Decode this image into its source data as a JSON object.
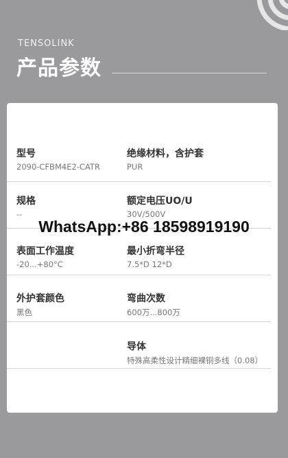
{
  "header": {
    "brand": "TENSOLINK",
    "title": "产品参数"
  },
  "specs": [
    {
      "label": "型号",
      "value": "2090-CFBM4E2-CATR"
    },
    {
      "label": "绝缘材料，含护套",
      "value": "PUR"
    },
    {
      "label": "规格",
      "value": "--"
    },
    {
      "label": "额定电压UO/U",
      "value": "30V/500V"
    },
    {
      "label": "表面工作温度",
      "value": "-20...+80°C"
    },
    {
      "label": "最小折弯半径",
      "value": "7.5*D   12*D"
    },
    {
      "label": "外护套颜色",
      "value": "黑色"
    },
    {
      "label": "弯曲次数",
      "value": "600万...800万"
    },
    {
      "label": "导体",
      "value": "特殊高柔性设计精细裸铜多线（0.08）"
    }
  ],
  "watermark": "WhatsApp:+86 18598919190",
  "colors": {
    "background": "#9a9a9c",
    "card": "#ffffff",
    "label": "#333333",
    "value": "#777777"
  }
}
